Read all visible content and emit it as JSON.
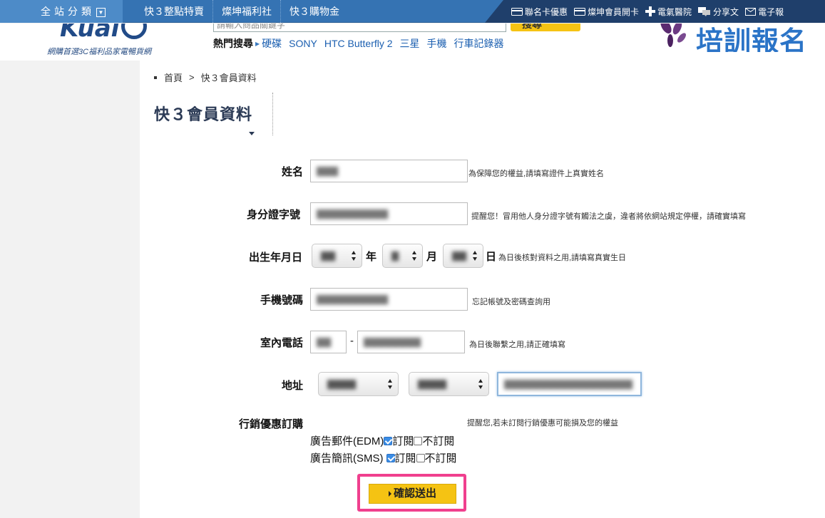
{
  "topnav": {
    "category": "全站分類",
    "category_toggle_icon": "dropdown-square-icon",
    "links": [
      "快３整點特賣",
      "燦坤福利社",
      "快３購物金"
    ],
    "right_items": [
      {
        "icon": "card-icon",
        "label": "聯名卡優惠"
      },
      {
        "icon": "card-icon",
        "label": "燦坤會員開卡"
      },
      {
        "icon": "plus-icon",
        "label": "電氣醫院"
      },
      {
        "icon": "chat-icon",
        "label": "分享文"
      },
      {
        "icon": "mail-icon",
        "label": "電子報"
      }
    ]
  },
  "header": {
    "logo_text": "Kuai",
    "tagline": "網購首選3C福利品家電暢貨網",
    "search_placeholder": "請輸入商品關鍵字",
    "search_button": "搜尋",
    "hot_label": "熱門搜尋",
    "hot_keywords": [
      "硬碟",
      "SONY",
      "HTC Butterfly 2",
      "三星",
      "手機",
      "行車記錄器"
    ],
    "banner_text": "培訓報名"
  },
  "breadcrumb": {
    "home": "首頁",
    "sep": ">",
    "current": "快３會員資料"
  },
  "page_title": "快３會員資料",
  "form": {
    "name": {
      "label": "姓名",
      "value": "▇▇▇",
      "hint": "為保障您的權益,請填寫證件上真實姓名"
    },
    "id_number": {
      "label": "身分證字號",
      "value": "▇▇▇▇▇▇▇▇▇▇",
      "hint": "提醒您！冒用他人身分證字號有觸法之虞，違者將依網站規定停權，請確實填寫"
    },
    "birthday": {
      "label": "出生年月日",
      "year": "▇▇",
      "year_unit": "年",
      "month": "▇",
      "month_unit": "月",
      "day": "▇▇",
      "day_unit": "日",
      "hint": "為日後核對資料之用,請填寫真實生日"
    },
    "mobile": {
      "label": "手機號碼",
      "value": "▇▇▇▇▇▇▇▇▇▇",
      "hint": "忘記帳號及密碼查詢用"
    },
    "phone": {
      "label": "室內電話",
      "area": "▇▇",
      "dash": "-",
      "number": "▇▇▇▇▇▇▇▇",
      "hint": "為日後聯繫之用,請正確填寫"
    },
    "address": {
      "label": "地址",
      "city": "▇▇▇▇",
      "district": "▇▇▇▇",
      "street": "▇▇▇▇▇▇▇▇▇▇▇▇▇▇▇▇▇▇"
    },
    "marketing": {
      "label": "行銷優惠訂購",
      "hint": "提醒您,若未訂閱行銷優惠可能損及您的權益",
      "edm": {
        "label": "廣告郵件(EDM)",
        "subscribe": "訂閱",
        "unsubscribe": "不訂閱",
        "subscribed": true
      },
      "sms": {
        "label": "廣告簡訊(SMS)",
        "subscribe": "訂閱",
        "unsubscribe": "不訂閱",
        "subscribed": true
      }
    },
    "submit_label": "確認送出"
  },
  "colors": {
    "nav_blue": "#3573b3",
    "nav_dark": "#1f3f6b",
    "accent_yellow": "#f5c313",
    "highlight_pink": "#f03f8e",
    "title_navy": "#2b3a55"
  }
}
